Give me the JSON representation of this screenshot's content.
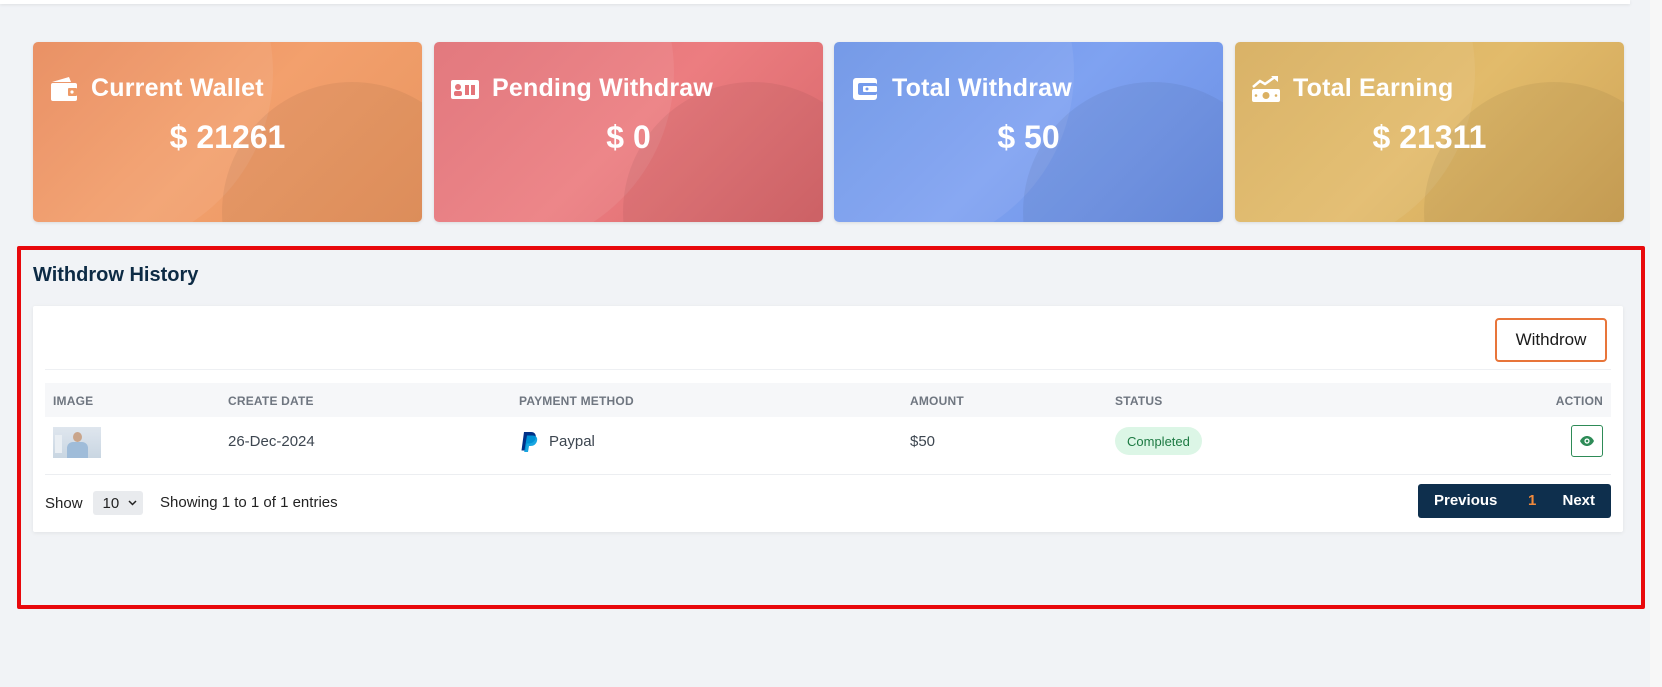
{
  "cards": [
    {
      "icon": "wallet-icon",
      "title": "Current Wallet",
      "value": "$ 21261"
    },
    {
      "icon": "id-card-icon",
      "title": "Pending Withdraw",
      "value": "$ 0"
    },
    {
      "icon": "wallet-card-icon",
      "title": "Total Withdraw",
      "value": "$ 50"
    },
    {
      "icon": "money-growth-icon",
      "title": "Total Earning",
      "value": "$ 21311"
    }
  ],
  "section": {
    "title": "Withdrow History",
    "withdraw_button": "Withdrow"
  },
  "table": {
    "headers": [
      "IMAGE",
      "CREATE DATE",
      "PAYMENT METHOD",
      "AMOUNT",
      "STATUS",
      "ACTION"
    ],
    "rows": [
      {
        "create_date": "26-Dec-2024",
        "payment_method": "Paypal",
        "amount": "$50",
        "status": "Completed"
      }
    ]
  },
  "footer": {
    "show_label": "Show",
    "page_size": "10",
    "info": "Showing 1 to 1 of 1 entries",
    "previous": "Previous",
    "current_page": "1",
    "next": "Next"
  },
  "colors": {
    "highlight_border": "#e8080c",
    "status_bg": "#dcf6e6",
    "status_text": "#1d7a43",
    "pager_bg": "#0e2f4d",
    "accent_orange": "#e8753a"
  }
}
